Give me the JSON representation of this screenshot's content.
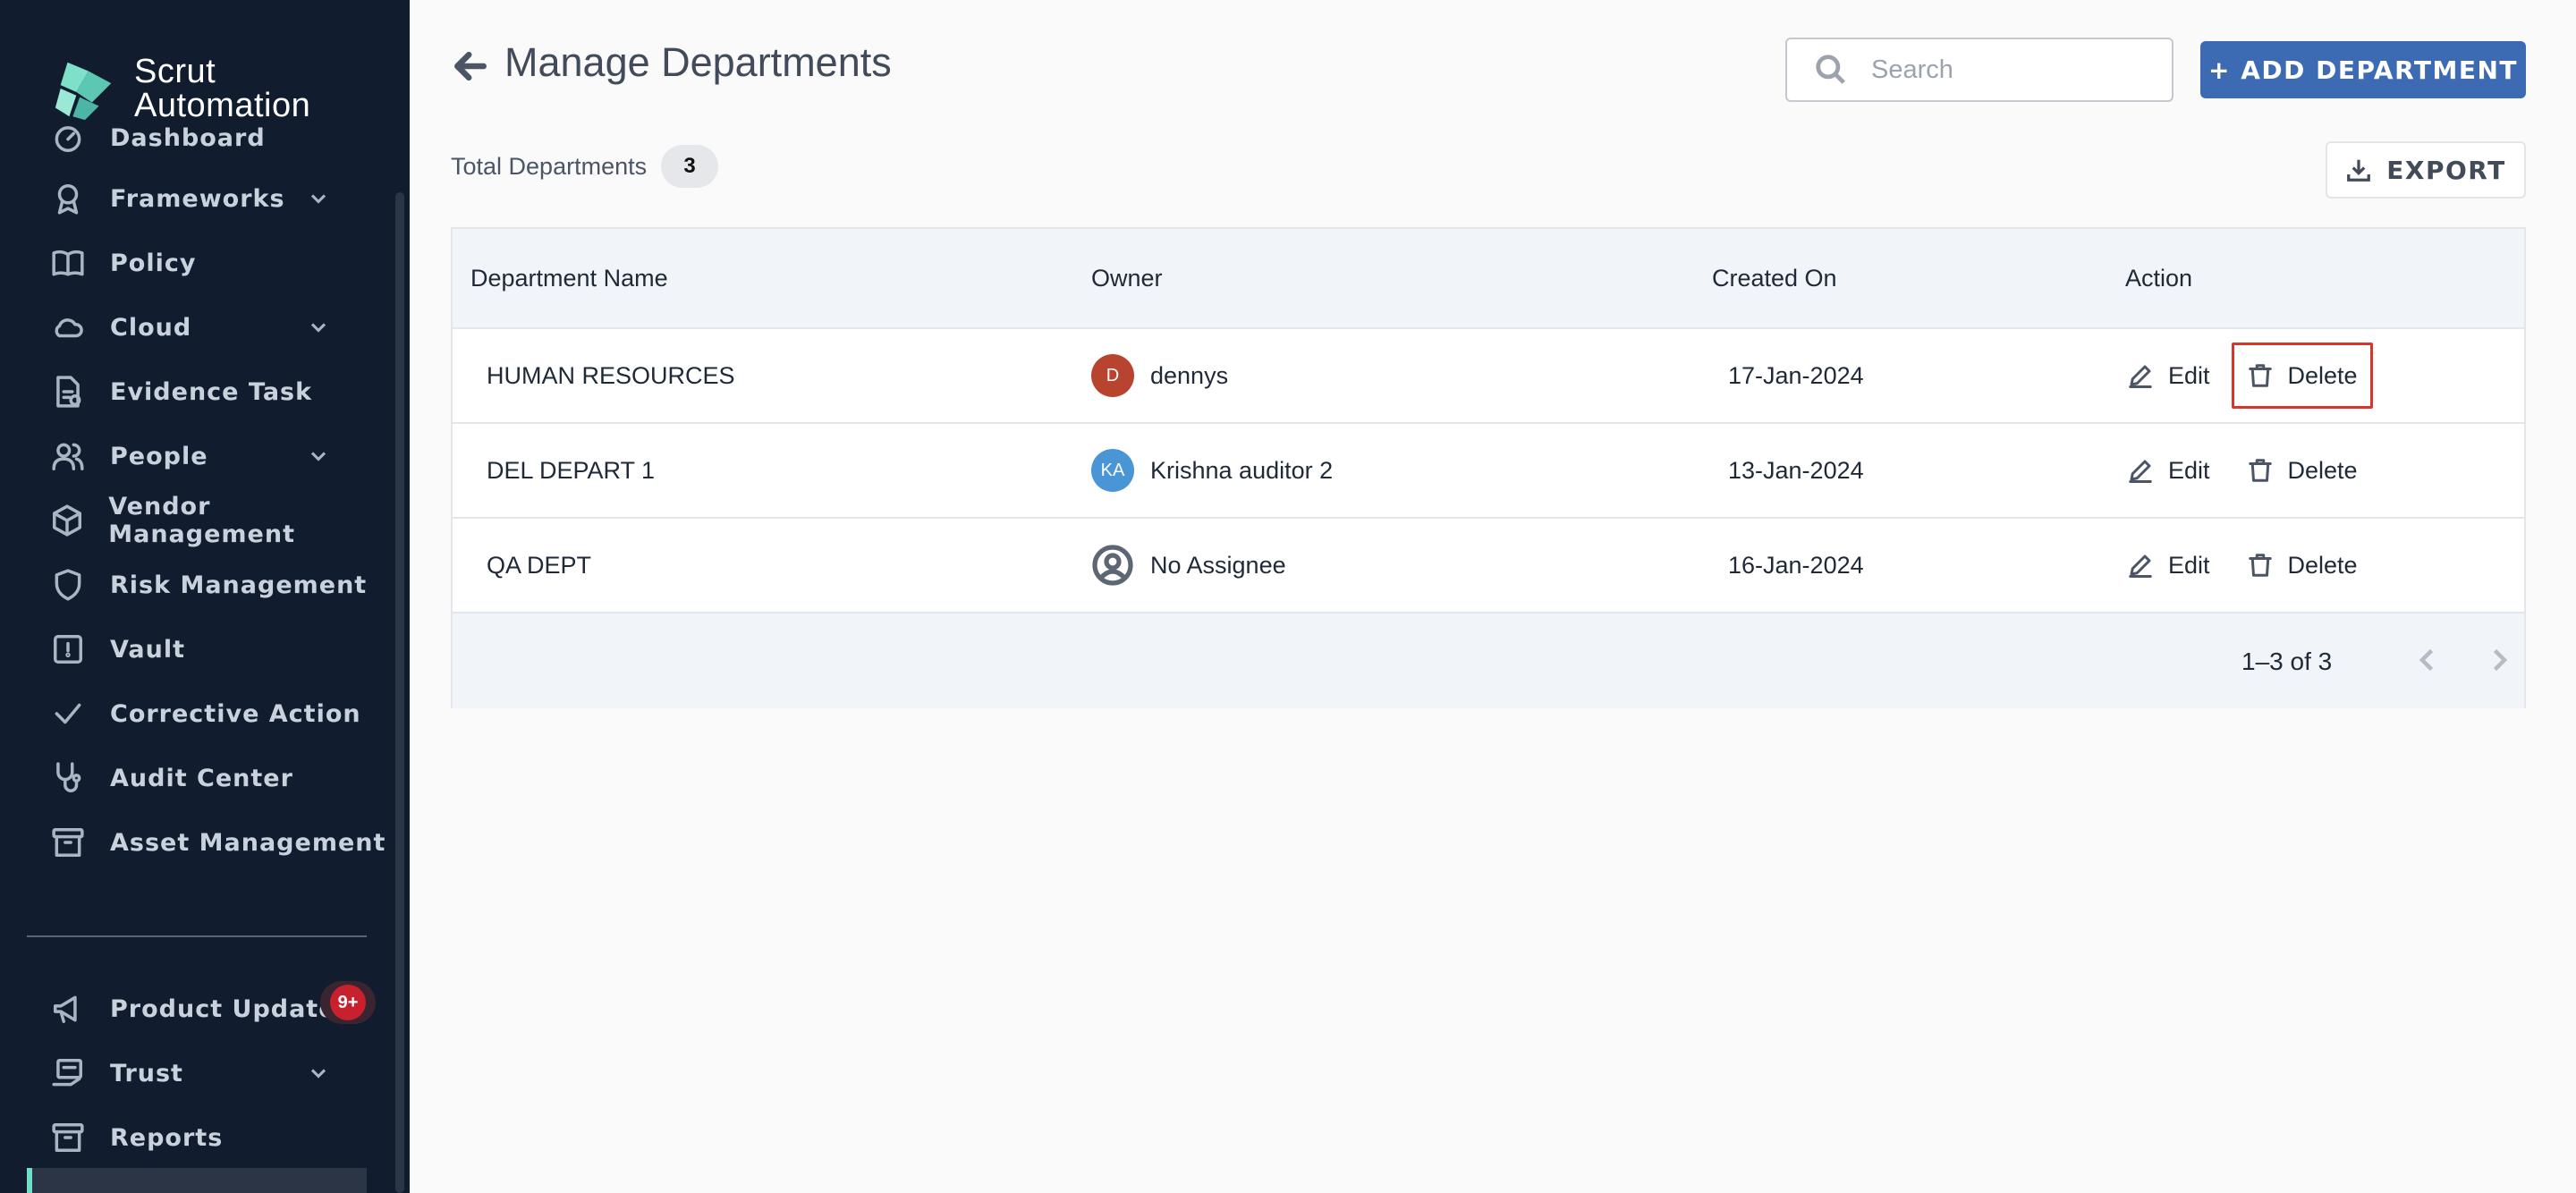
{
  "brand": {
    "line1": "Scrut",
    "line2": "Automation"
  },
  "sidebar": {
    "items": [
      {
        "label": "Dashboard",
        "icon": "dashboard-icon",
        "chevron": false
      },
      {
        "label": "Frameworks",
        "icon": "award-icon",
        "chevron": true
      },
      {
        "label": "Policy",
        "icon": "book-icon",
        "chevron": false
      },
      {
        "label": "Cloud",
        "icon": "cloud-icon",
        "chevron": true
      },
      {
        "label": "Evidence Task",
        "icon": "evidence-icon",
        "chevron": false
      },
      {
        "label": "People",
        "icon": "people-icon",
        "chevron": true
      },
      {
        "label": "Vendor Management",
        "icon": "box-icon",
        "chevron": false
      },
      {
        "label": "Risk Management",
        "icon": "shield-icon",
        "chevron": false
      },
      {
        "label": "Vault",
        "icon": "vault-icon",
        "chevron": false
      },
      {
        "label": "Corrective Action",
        "icon": "check-icon",
        "chevron": false
      },
      {
        "label": "Audit Center",
        "icon": "stethoscope-icon",
        "chevron": false
      },
      {
        "label": "Asset Management",
        "icon": "archive-icon",
        "chevron": false
      }
    ],
    "bottom_items": [
      {
        "label": "Product Updates",
        "icon": "megaphone-icon",
        "chevron": false
      },
      {
        "label": "Trust",
        "icon": "trust-icon",
        "chevron": true
      },
      {
        "label": "Reports",
        "icon": "archive-icon",
        "chevron": false
      }
    ],
    "updates_badge": "9+"
  },
  "header": {
    "title": "Manage Departments",
    "search_placeholder": "Search",
    "add_button": "+ ADD DEPARTMENT",
    "export_button": "EXPORT"
  },
  "summary": {
    "label": "Total Departments",
    "count": "3"
  },
  "table": {
    "columns": [
      "Department Name",
      "Owner",
      "Created On",
      "Action"
    ],
    "rows": [
      {
        "name": "HUMAN RESOURCES",
        "owner": "dennys",
        "avatar": "D",
        "avatar_color": "#b8432f",
        "created": "17-Jan-2024",
        "edit": "Edit",
        "delete": "Delete"
      },
      {
        "name": "DEL DEPART 1",
        "owner": "Krishna auditor 2",
        "avatar": "KA",
        "avatar_color": "#4a95d6",
        "created": "13-Jan-2024",
        "edit": "Edit",
        "delete": "Delete"
      },
      {
        "name": "QA DEPT",
        "owner": "No Assignee",
        "avatar": "",
        "avatar_color": "",
        "created": "16-Jan-2024",
        "edit": "Edit",
        "delete": "Delete"
      }
    ],
    "pagination": "1–3 of 3"
  },
  "colors": {
    "primary": "#3d6bb3",
    "sidebar_bg": "#111d2e",
    "highlight": "#d9362b",
    "accent": "#6fe0c5"
  }
}
